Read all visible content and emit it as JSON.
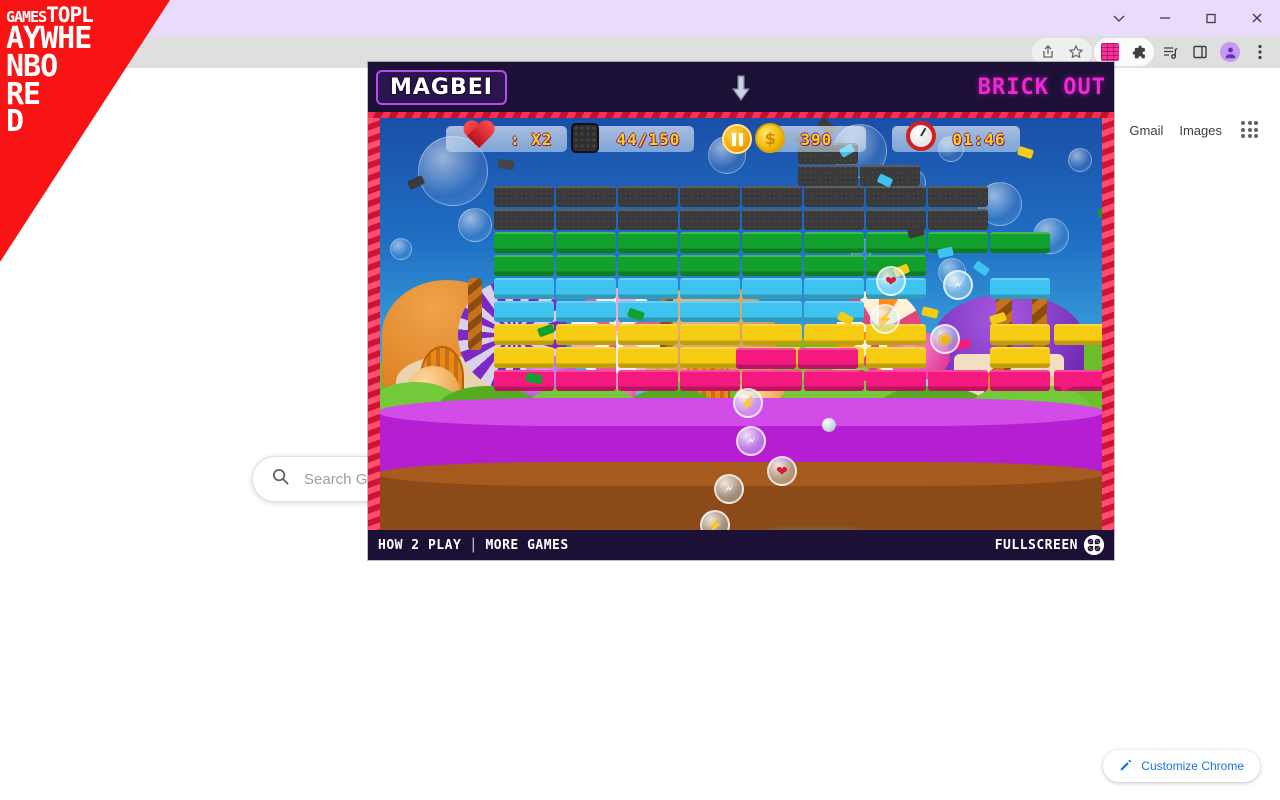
{
  "browser": {
    "titlebar": {
      "controls": [
        {
          "name": "tab-search",
          "glyph": "chevron-down"
        },
        {
          "name": "minimize",
          "glyph": "minus"
        },
        {
          "name": "maximize",
          "glyph": "square"
        },
        {
          "name": "close",
          "glyph": "cross"
        }
      ]
    },
    "toolbar": {
      "icons": [
        {
          "name": "share-icon",
          "label": "Share"
        },
        {
          "name": "bookmark-star-icon",
          "label": "Bookmark this tab"
        },
        {
          "name": "brick-extension-icon",
          "label": "Brick Out extension"
        },
        {
          "name": "extensions-puzzle-icon",
          "label": "Extensions"
        },
        {
          "name": "reading-list-icon",
          "label": "Reading list"
        },
        {
          "name": "side-panel-icon",
          "label": "Side panel"
        },
        {
          "name": "profile-avatar-icon",
          "label": "Profile"
        },
        {
          "name": "chrome-menu-icon",
          "label": "Customize and control Google Chrome"
        }
      ]
    }
  },
  "newtab": {
    "links": [
      {
        "label": "Gmail"
      },
      {
        "label": "Images"
      }
    ],
    "apps_label": "Google apps",
    "search": {
      "placeholder": "Search Google or type a URL",
      "value": ""
    },
    "customize": {
      "label": "Customize Chrome",
      "accent": "#1a73e8"
    }
  },
  "ribbon": {
    "line1_small": "GAMES",
    "line1_large": "TOPL",
    "line2": "AYWHE",
    "line3": "NBO",
    "line4": "RE",
    "line5": "D",
    "full_text": "GAMESTOPLAYWHENBORED",
    "color": "#f81414"
  },
  "game": {
    "brand": "MAGBEI",
    "title": "BRICK OUT",
    "title_color": "#f027d4",
    "download_icon": "download-arrow-icon",
    "watermark": "MAGBEI",
    "hud": {
      "lives": {
        "icon": "heart-icon",
        "value": ": X2"
      },
      "bricks": {
        "icon": "brick-icon",
        "value": "44/150"
      },
      "pause": {
        "icon": "pause-icon",
        "label": "Pause"
      },
      "coins": {
        "icon": "coin-icon",
        "value": "390"
      },
      "timer": {
        "icon": "alarm-clock-icon",
        "value": "01:46"
      }
    },
    "footer": {
      "how_to_play": "HOW 2 PLAY",
      "separator": "|",
      "more_games": "MORE GAMES",
      "fullscreen": "FULLSCREEN",
      "fullscreen_icon": "fullscreen-icon"
    },
    "powerups": [
      {
        "name": "lightning-powerup",
        "glyph": "⚡"
      },
      {
        "name": "heart-powerup",
        "glyph": "❤"
      },
      {
        "name": "coin-powerup",
        "glyph": "◉"
      },
      {
        "name": "rocket-powerup",
        "glyph": "🗲"
      }
    ],
    "brick_colors": {
      "dark": "#3a3a3a",
      "green": "#12a02c",
      "cyan": "#3fc4f0",
      "yellow": "#f6cc13",
      "pink": "#f4197e"
    }
  }
}
